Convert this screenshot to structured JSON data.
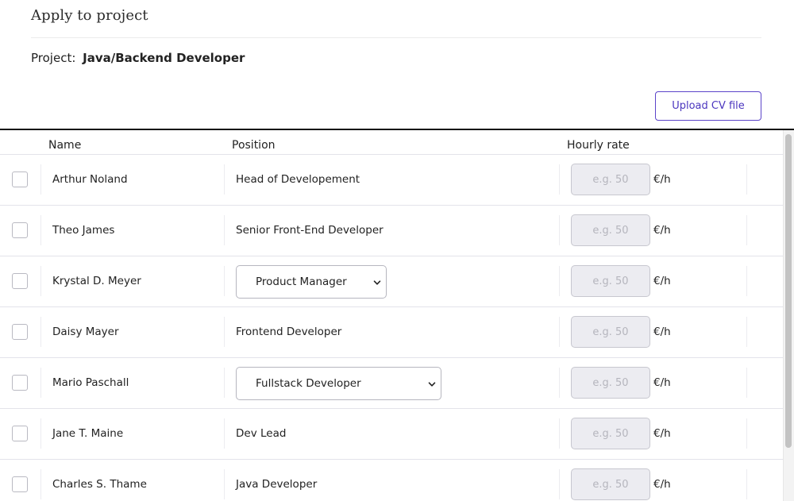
{
  "header": {
    "title": "Apply to project",
    "project_label": "Project:",
    "project_name": "Java/Backend Developer",
    "upload_label": "Upload CV file"
  },
  "table": {
    "columns": {
      "name": "Name",
      "position": "Position",
      "rate": "Hourly rate"
    },
    "rate_placeholder": "e.g. 50",
    "rate_unit": "€/h",
    "rows": [
      {
        "name": "Arthur Noland",
        "position": "Head of Developement",
        "position_type": "text"
      },
      {
        "name": "Theo James",
        "position": "Senior Front-End Developer",
        "position_type": "text"
      },
      {
        "name": "Krystal D. Meyer",
        "position": "Product Manager",
        "position_type": "select"
      },
      {
        "name": "Daisy Mayer",
        "position": "Frontend Developer",
        "position_type": "text"
      },
      {
        "name": "Mario Paschall",
        "position": "Fullstack Developer",
        "position_type": "select"
      },
      {
        "name": "Jane T. Maine",
        "position": "Dev Lead",
        "position_type": "text"
      },
      {
        "name": "Charles S. Thame",
        "position": "Java Developer",
        "position_type": "text"
      }
    ]
  },
  "colors": {
    "accent": "#5b44c9",
    "input_bg": "#ececf1",
    "border": "#e3e3ea"
  },
  "icons": {
    "select_chevron": "chevron-down-icon"
  }
}
